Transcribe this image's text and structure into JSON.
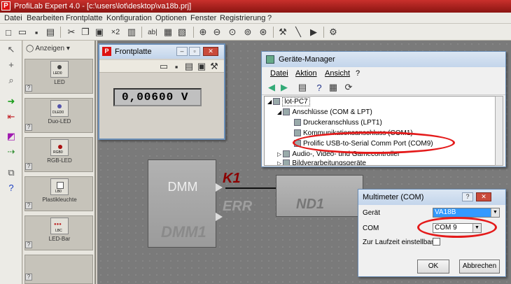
{
  "app": {
    "title": "ProfiLab Expert 4.0 - [c:\\users\\lot\\desktop\\va18b.prj]",
    "logo": "P"
  },
  "menu": [
    "Datei",
    "Bearbeiten",
    "Frontplatte",
    "Konfiguration",
    "Optionen",
    "Fenster",
    "Registrierung",
    "?"
  ],
  "toolbar": {
    "ab_label": "ab|",
    "x2_label": "×2"
  },
  "palette": {
    "view_label": "Anzeigen",
    "items": [
      {
        "label": "LED",
        "icon_text": "LED0"
      },
      {
        "label": "Duo-LED",
        "icon_text": "DLED0"
      },
      {
        "label": "RGB-LED",
        "icon_text": "RGB0"
      },
      {
        "label": "Plastikleuchte",
        "icon_text": "LB0"
      },
      {
        "label": "LED-Bar",
        "icon_text": "LBC"
      }
    ]
  },
  "frontplatte": {
    "title": "Frontplatte",
    "display_value": "0,00600  V"
  },
  "canvas": {
    "dmm_text": "DMM",
    "dmm_name": "DMM1",
    "k1": "K1",
    "err": "ERR",
    "nd_name": "ND1"
  },
  "device_manager": {
    "title": "Geräte-Manager",
    "menu": [
      "Datei",
      "Aktion",
      "Ansicht",
      "?"
    ],
    "tree": [
      {
        "text": "lot-PC7"
      },
      {
        "text": "Anschlüsse (COM & LPT)"
      },
      {
        "text": "Druckeranschluss (LPT1)"
      },
      {
        "text": "Kommunikationsanschluss (COM1)"
      },
      {
        "text": "Prolific USB-to-Serial Comm Port (COM9)"
      },
      {
        "text": "Audio-, Video- und Gamecontroller"
      },
      {
        "text": "Bildverarbeitungsgeräte"
      }
    ]
  },
  "multimeter": {
    "title": "Multimeter (COM)",
    "help": "?",
    "geraet_label": "Gerät",
    "geraet_value": "VA18B",
    "com_label": "COM",
    "com_value": "COM 9",
    "runtime_label": "Zur Laufzeit einstellbar",
    "ok_label": "OK",
    "cancel_label": "Abbrechen"
  },
  "colors": {
    "annotation": "#e41a1a",
    "title_bar": "#b32420"
  }
}
